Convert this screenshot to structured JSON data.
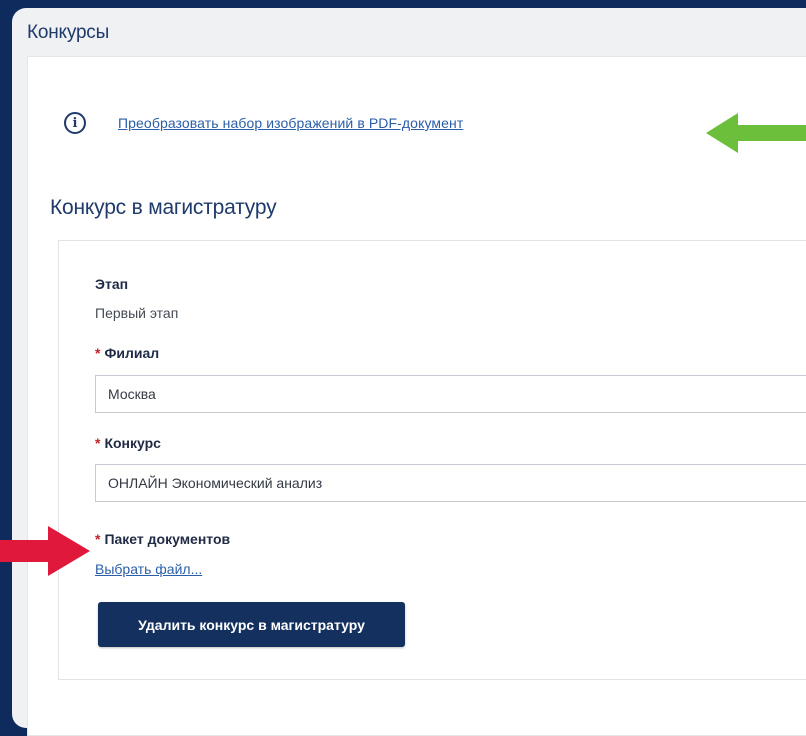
{
  "window": {
    "title": "Конкурсы"
  },
  "info": {
    "link_text": "Преобразовать набор изображений в PDF-документ",
    "icon": "info-icon"
  },
  "section": {
    "title": "Конкурс в магистратуру"
  },
  "form": {
    "stage_label": "Этап",
    "stage_value": "Первый этап",
    "branch_label": "Филиал",
    "branch_value": "Москва",
    "contest_label": "Конкурс",
    "contest_value": "ОНЛАЙН Экономический анализ",
    "package_label": "Пакет документов",
    "choose_file": "Выбрать файл...",
    "required_marker": "*",
    "delete_button": "Удалить конкурс в магистратуру"
  },
  "colors": {
    "background": "#0f2a5c",
    "button": "#14305f",
    "link": "#2b5ea8",
    "required": "#c0242f",
    "green_arrow": "#6cbf3b",
    "red_arrow": "#e0183c"
  }
}
